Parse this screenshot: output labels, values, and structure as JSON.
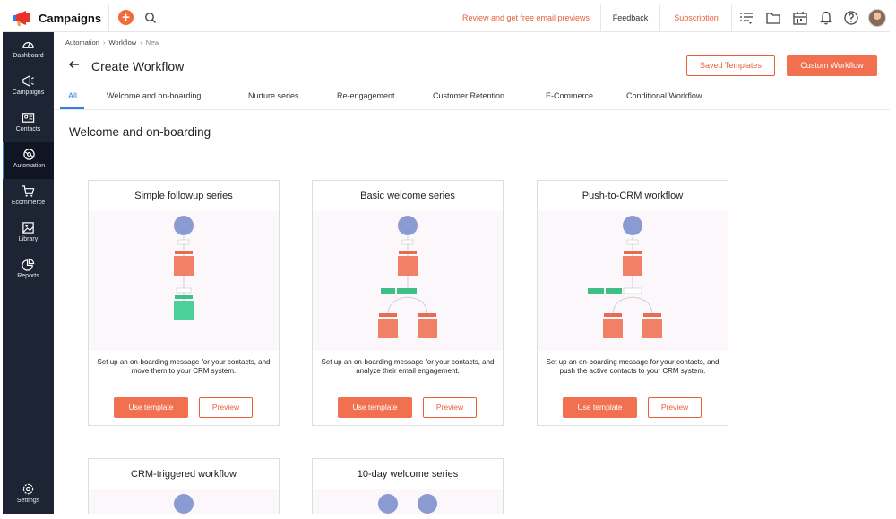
{
  "app": {
    "name": "Campaigns",
    "accent": "#f07050",
    "active_blue": "#2f7fe8",
    "sidebar_bg": "#1d2433"
  },
  "topbar": {
    "review_link": "Review and get free email previews",
    "feedback": "Feedback",
    "subscription": "Subscription",
    "icons": [
      "plus-icon",
      "search-icon",
      "list-filter-icon",
      "folder-icon",
      "calendar-icon",
      "bell-icon",
      "help-icon",
      "avatar"
    ]
  },
  "sidebar": {
    "items": [
      {
        "label": "Dashboard",
        "icon": "dashboard-icon"
      },
      {
        "label": "Campaigns",
        "icon": "megaphone-icon"
      },
      {
        "label": "Contacts",
        "icon": "contacts-icon"
      },
      {
        "label": "Automation",
        "icon": "automation-icon"
      },
      {
        "label": "Ecommerce",
        "icon": "cart-icon"
      },
      {
        "label": "Library",
        "icon": "library-icon"
      },
      {
        "label": "Reports",
        "icon": "reports-icon"
      }
    ],
    "settings": "Settings",
    "active": "Automation"
  },
  "breadcrumb": [
    "Automation",
    "Workflow",
    "New"
  ],
  "header": {
    "title": "Create Workflow",
    "saved_templates": "Saved Templates",
    "custom_workflow": "Custom Workflow"
  },
  "tabs": [
    "All",
    "Welcome and on-boarding",
    "Nurture series",
    "Re-engagement",
    "Customer Retention",
    "E-Commerce",
    "Conditional Workflow"
  ],
  "active_tab": "All",
  "section": {
    "title": "Welcome and on-boarding"
  },
  "cards": [
    {
      "title": "Simple followup series",
      "description": "Set up an on-boarding message for your contacts, and move them to your CRM system.",
      "use_label": "Use template",
      "preview_label": "Preview"
    },
    {
      "title": "Basic welcome series",
      "description": "Set up an on-boarding message for your contacts, and analyze their email engagement.",
      "use_label": "Use template",
      "preview_label": "Preview"
    },
    {
      "title": "Push-to-CRM workflow",
      "description": "Set up an on-boarding message for your contacts, and push the active contacts to your CRM system.",
      "use_label": "Use template",
      "preview_label": "Preview"
    },
    {
      "title": "CRM-triggered workflow"
    },
    {
      "title": "10-day welcome series"
    }
  ]
}
